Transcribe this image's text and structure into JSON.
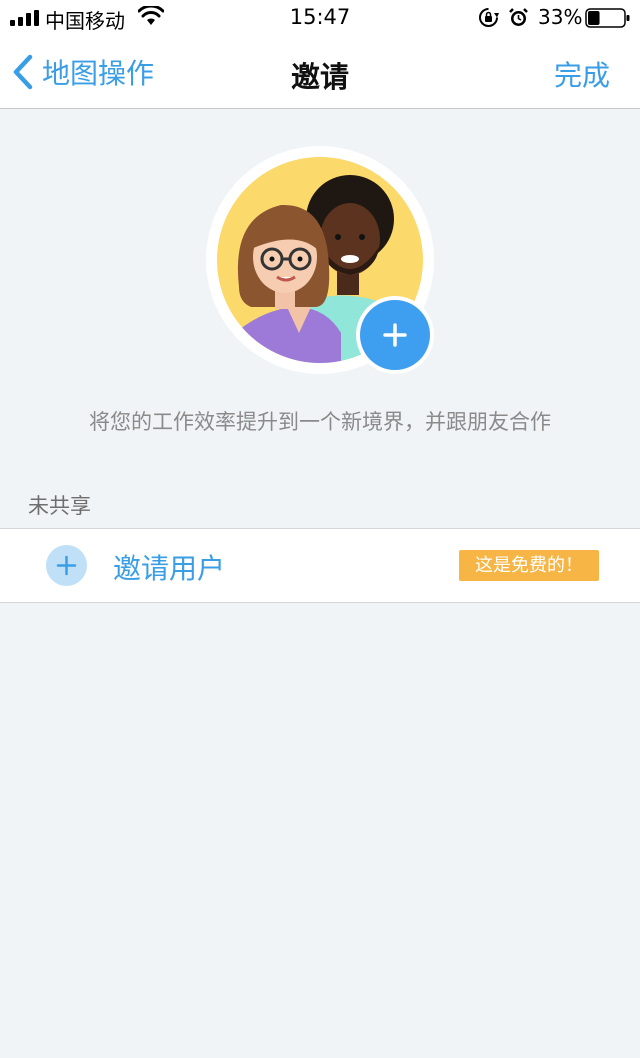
{
  "status_bar": {
    "carrier": "中国移动",
    "time": "15:47",
    "battery_percent": "33%",
    "battery_level": 0.33
  },
  "nav": {
    "back_label": "地图操作",
    "title": "邀请",
    "done_label": "完成"
  },
  "main": {
    "tagline": "将您的工作效率提升到一个新境界，并跟朋友合作",
    "section_header": "未共享",
    "invite_row": {
      "label": "邀请用户",
      "badge": "这是免费的！"
    }
  },
  "colors": {
    "accent": "#3a9ee6",
    "badge": "#f6b544",
    "background": "#f1f4f7"
  },
  "icons": {
    "back": "chevron-left-icon",
    "add": "plus-icon",
    "wifi": "wifi-icon",
    "alarm": "alarm-clock-icon",
    "orientation_lock": "orientation-lock-icon"
  }
}
